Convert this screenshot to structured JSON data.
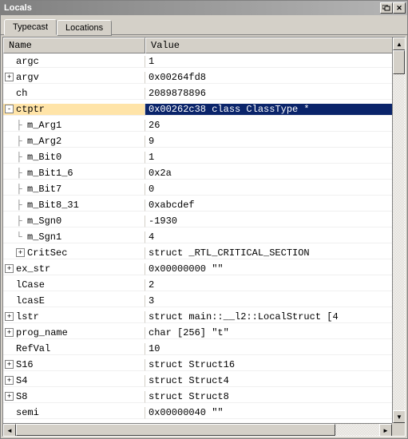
{
  "window": {
    "title": "Locals"
  },
  "tabs": [
    {
      "label": "Typecast",
      "active": true
    },
    {
      "label": "Locations",
      "active": false
    }
  ],
  "columns": {
    "name": "Name",
    "value": "Value"
  },
  "rows": [
    {
      "indent": 0,
      "expander": "",
      "prefix": "",
      "name": "argc",
      "value": "1",
      "selected": false
    },
    {
      "indent": 0,
      "expander": "+",
      "prefix": "",
      "name": "argv",
      "value": "0x00264fd8",
      "selected": false
    },
    {
      "indent": 0,
      "expander": "",
      "prefix": "",
      "name": "ch",
      "value": "2089878896",
      "selected": false
    },
    {
      "indent": 0,
      "expander": "-",
      "prefix": "",
      "name": "ctptr",
      "value": "0x00262c38 class ClassType *",
      "selected": true
    },
    {
      "indent": 1,
      "expander": "",
      "prefix": "├",
      "name": "m_Arg1",
      "value": "26",
      "selected": false
    },
    {
      "indent": 1,
      "expander": "",
      "prefix": "├",
      "name": "m_Arg2",
      "value": "9",
      "selected": false
    },
    {
      "indent": 1,
      "expander": "",
      "prefix": "├",
      "name": "m_Bit0",
      "value": "1",
      "selected": false
    },
    {
      "indent": 1,
      "expander": "",
      "prefix": "├",
      "name": "m_Bit1_6",
      "value": "0x2a",
      "selected": false
    },
    {
      "indent": 1,
      "expander": "",
      "prefix": "├",
      "name": "m_Bit7",
      "value": "0",
      "selected": false
    },
    {
      "indent": 1,
      "expander": "",
      "prefix": "├",
      "name": "m_Bit8_31",
      "value": "0xabcdef",
      "selected": false
    },
    {
      "indent": 1,
      "expander": "",
      "prefix": "├",
      "name": "m_Sgn0",
      "value": "-1930",
      "selected": false
    },
    {
      "indent": 1,
      "expander": "",
      "prefix": "└",
      "name": "m_Sgn1",
      "value": "4",
      "selected": false
    },
    {
      "indent": 1,
      "expander": "+",
      "prefix": "",
      "name": "CritSec",
      "value": "struct _RTL_CRITICAL_SECTION",
      "selected": false
    },
    {
      "indent": 0,
      "expander": "+",
      "prefix": "",
      "name": "ex_str",
      "value": "0x00000000 \"\"",
      "selected": false
    },
    {
      "indent": 0,
      "expander": "",
      "prefix": "",
      "name": "lCase",
      "value": "2",
      "selected": false
    },
    {
      "indent": 0,
      "expander": "",
      "prefix": "",
      "name": "lcasE",
      "value": "3",
      "selected": false
    },
    {
      "indent": 0,
      "expander": "+",
      "prefix": "",
      "name": "lstr",
      "value": "struct main::__l2::LocalStruct [4",
      "selected": false
    },
    {
      "indent": 0,
      "expander": "+",
      "prefix": "",
      "name": "prog_name",
      "value": "char [256] \"t\"",
      "selected": false
    },
    {
      "indent": 0,
      "expander": "",
      "prefix": "",
      "name": "RefVal",
      "value": "10",
      "selected": false
    },
    {
      "indent": 0,
      "expander": "+",
      "prefix": "",
      "name": "S16",
      "value": "struct Struct16",
      "selected": false
    },
    {
      "indent": 0,
      "expander": "+",
      "prefix": "",
      "name": "S4",
      "value": "struct Struct4",
      "selected": false
    },
    {
      "indent": 0,
      "expander": "+",
      "prefix": "",
      "name": "S8",
      "value": "struct Struct8",
      "selected": false
    },
    {
      "indent": 0,
      "expander": "",
      "prefix": "",
      "name": "semi",
      "value": "0x00000040 \"\"",
      "selected": false
    }
  ]
}
